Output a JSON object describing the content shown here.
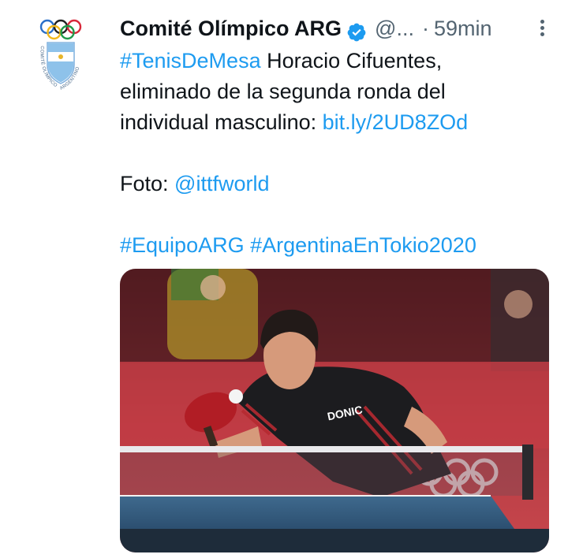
{
  "tweet": {
    "author_name": "Comité Olímpico ARG",
    "handle": "@...",
    "separator": "·",
    "time": "59min",
    "text": {
      "hashtag1": "#TenisDeMesa",
      "line1_rest": " Horacio Cifuentes,",
      "line2": "eliminado de la segunda ronda del",
      "line3_prefix": "individual masculino: ",
      "link_url": "bit.ly/2UD8ZOd",
      "photo_prefix": "Foto: ",
      "photo_mention": "@ittfworld",
      "hashtag2": "#EquipoARG",
      "hashtag3": "#ArgentinaEnTokio2020"
    },
    "avatar": {
      "logo_text": "COMITÉ OLÍMPICO ARGENTINO"
    },
    "media": {
      "jersey_brand": "DONIC"
    }
  },
  "colors": {
    "link": "#1d9bf0",
    "text": "#0f1419",
    "secondary": "#536471",
    "verified": "#1d9bf0"
  },
  "icons": {
    "verified": "verified-badge-icon",
    "more": "more-options-icon"
  }
}
